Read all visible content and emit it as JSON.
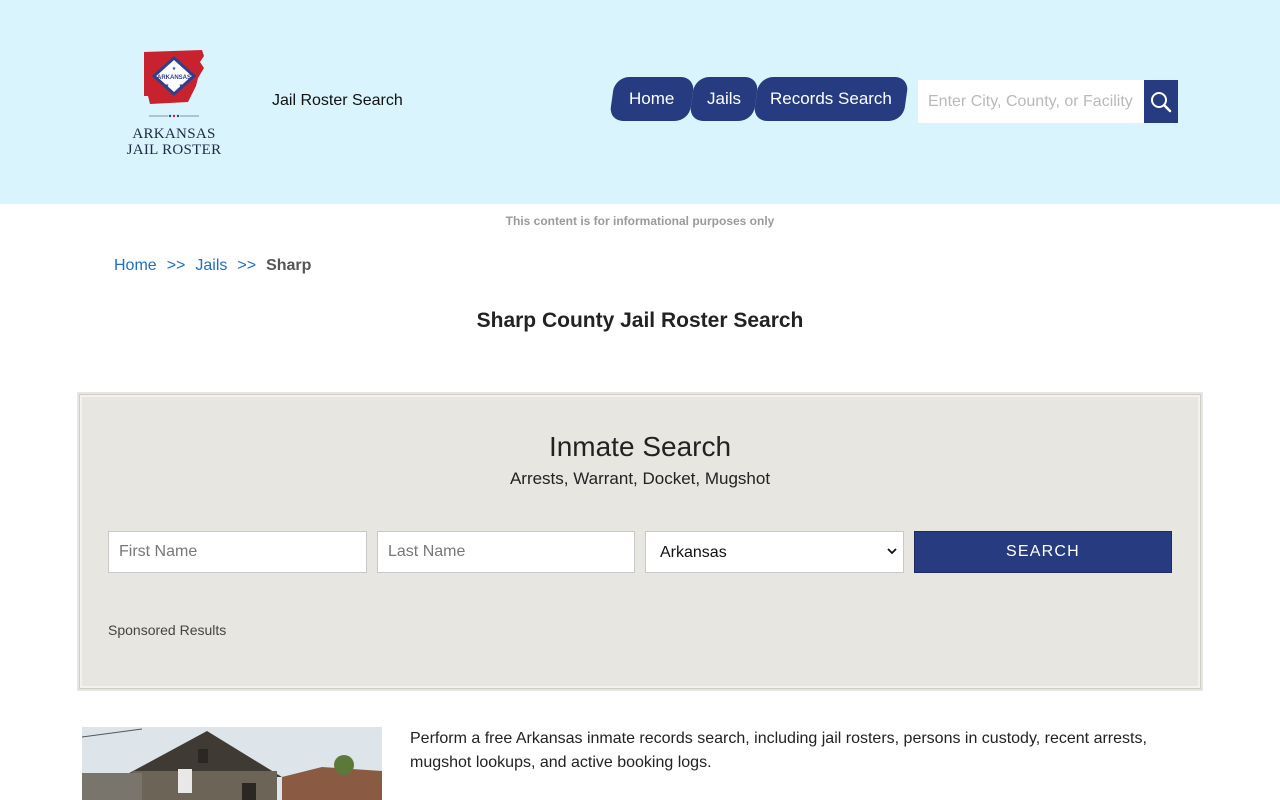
{
  "header": {
    "logo_text_line1": "ARKANSAS",
    "logo_text_line2": "JAIL ROSTER",
    "logo_badge": "ARKANSAS",
    "tagline": "Jail Roster Search",
    "nav": [
      {
        "label": "Home"
      },
      {
        "label": "Jails"
      },
      {
        "label": "Records Search"
      }
    ],
    "search_placeholder": "Enter City, County, or Facility",
    "search_icon": "search-icon"
  },
  "disclaimer": "This content is for informational purposes only",
  "breadcrumb": {
    "items": [
      "Home",
      "Jails"
    ],
    "separator": ">>",
    "current": "Sharp"
  },
  "page_title": "Sharp County Jail Roster Search",
  "inmate_search": {
    "title": "Inmate Search",
    "subtitle": "Arrests, Warrant, Docket, Mugshot",
    "first_name_placeholder": "First Name",
    "last_name_placeholder": "Last Name",
    "state_selected": "Arkansas",
    "submit_label": "SEARCH",
    "sponsored": "Sponsored Results"
  },
  "intro_text": "Perform a free Arkansas inmate records search, including jail rosters, persons in custody, recent arrests, mugshot lookups, and active booking logs.",
  "colors": {
    "header_bg": "#d9f4fd",
    "brand_blue": "#263b80",
    "link_blue": "#1a6fc4",
    "panel_bg": "#e8e6e1"
  }
}
